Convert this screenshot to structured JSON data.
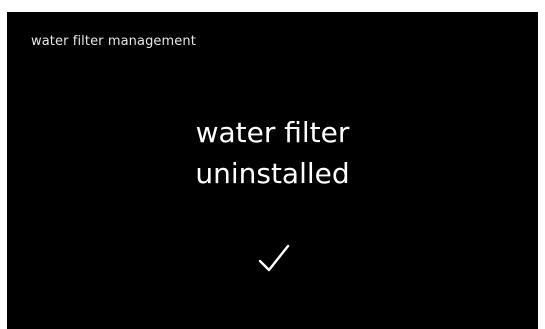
{
  "header": {
    "title": "water filter management"
  },
  "message": {
    "line1": "water filter",
    "line2": "uninstalled"
  },
  "confirm": {
    "icon": "checkmark-icon"
  },
  "colors": {
    "background": "#000000",
    "text": "#ffffff"
  }
}
